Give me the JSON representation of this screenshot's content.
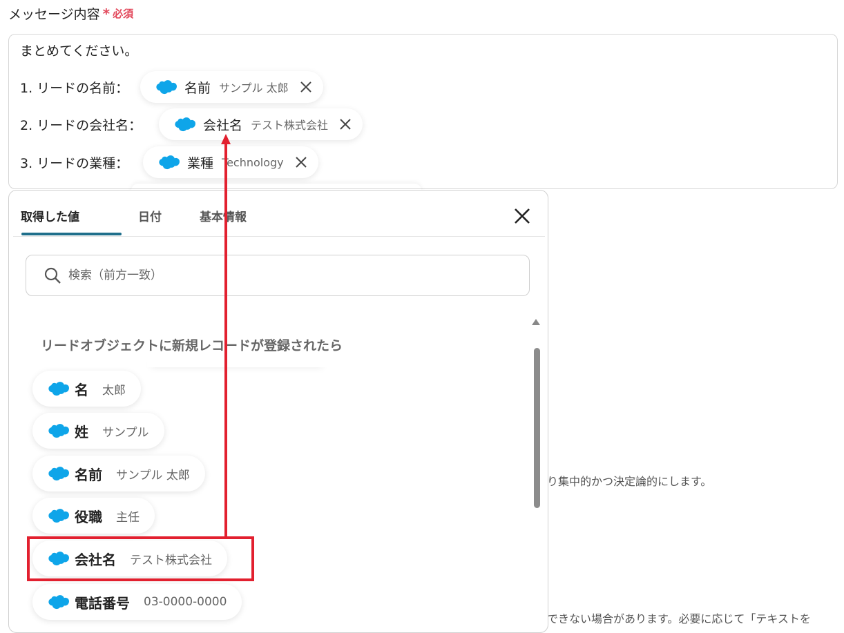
{
  "field": {
    "label": "メッセージ内容",
    "required_mark": "*",
    "required_text": "必須"
  },
  "message": {
    "intro": "まとめてください。",
    "lines": [
      {
        "prefix": "1. リードの名前：",
        "pill_name": "名前",
        "pill_value": "サンプル 太郎"
      },
      {
        "prefix": "2. リードの会社名：",
        "pill_name": "会社名",
        "pill_value": "テスト株式会社"
      },
      {
        "prefix": "3. リードの業種：",
        "pill_name": "業種",
        "pill_value": "Technology"
      }
    ]
  },
  "panel": {
    "tabs": [
      "取得した値",
      "日付",
      "基本情報"
    ],
    "active_tab": 0,
    "search_placeholder": "検索（前方一致）",
    "group_title": "リードオブジェクトに新規レコードが登録されたら",
    "items": [
      {
        "name": "名",
        "value": "太郎"
      },
      {
        "name": "姓",
        "value": "サンプル"
      },
      {
        "name": "名前",
        "value": "サンプル 太郎"
      },
      {
        "name": "役職",
        "value": "主任"
      },
      {
        "name": "会社名",
        "value": "テスト株式会社"
      },
      {
        "name": "電話番号",
        "value": "03-0000-0000"
      }
    ]
  },
  "background_text": {
    "line1": "り集中的かつ決定論的にします。",
    "line2": "できない場合があります。必要に応じて「テキストを"
  },
  "colors": {
    "salesforce_blue": "#0ea5e9",
    "required_red": "#e2475a",
    "highlight_red": "#e2202f",
    "tab_underline": "#1f6f8b"
  },
  "icons": {
    "salesforce": "salesforce-cloud-icon",
    "remove": "close-icon",
    "search": "search-icon",
    "collapse": "chevron-up-icon"
  }
}
